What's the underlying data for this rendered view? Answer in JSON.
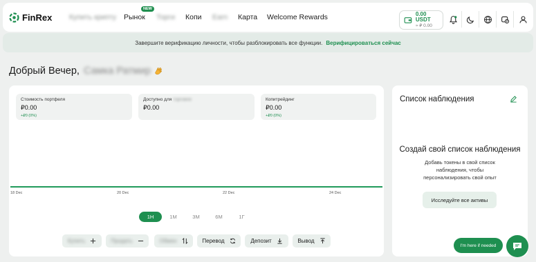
{
  "app": {
    "brand": "FinRex"
  },
  "nav": {
    "items": [
      {
        "label": "Купить криптy"
      },
      {
        "label": "Рынок",
        "badge": "NEW"
      },
      {
        "label": "Торги"
      },
      {
        "label": "Копи"
      },
      {
        "label": "Earn"
      },
      {
        "label": "Карта"
      },
      {
        "label": "Welcome Rewards"
      }
    ]
  },
  "header": {
    "balance_main": "0.00 USDT",
    "balance_sub": "≈ ₽ 0.00",
    "icons": [
      "bell-icon",
      "moon-icon",
      "globe-icon",
      "currency-icon",
      "user-icon"
    ]
  },
  "verify": {
    "text": "Завершите верификацию личности, чтобы разблокировать все функции.",
    "link": "Верифицироваться сейчас"
  },
  "greeting": {
    "text": "Добрый Вечер,",
    "name": "Самка Ратмир"
  },
  "stats": [
    {
      "label": "Стоимость портфеля",
      "value": "₽0.00",
      "change": "+₽0 (0%)"
    },
    {
      "label": "Доступно для",
      "label_suffix": "торговли",
      "value": "₽0.00"
    },
    {
      "label": "Копитрейдинг",
      "value": "₽0.00",
      "change": "+₽0 (0%)"
    }
  ],
  "chart_data": {
    "type": "line",
    "x": [
      "18 Dec",
      "20 Dec",
      "22 Dec",
      "24 Dec"
    ],
    "series": [
      {
        "values": [
          0,
          0,
          0,
          0
        ]
      }
    ],
    "title": "",
    "xlabel": "",
    "ylabel": ""
  },
  "ranges": {
    "items": [
      "1H",
      "1M",
      "3M",
      "6M",
      "1Г"
    ],
    "active": "1H"
  },
  "actions": [
    {
      "label": "Купить",
      "icon": "plus-icon",
      "blurred": true
    },
    {
      "label": "Продать",
      "icon": "minus-icon",
      "blurred": true
    },
    {
      "label": "Обмен",
      "icon": "swap-icon",
      "blurred": true
    },
    {
      "label": "Перевод",
      "icon": "refresh-icon"
    },
    {
      "label": "Депозит",
      "icon": "download-icon"
    },
    {
      "label": "Вывод",
      "icon": "upload-icon"
    }
  ],
  "watchlist": {
    "title": "Список наблюдения",
    "empty_title": "Создай свой список наблюдения",
    "empty_desc": "Добавь токены в свой список наблюдения, чтобы персонализировать свой опыт",
    "button": "Исследуйте все активы"
  },
  "help": {
    "label": "I'm here if needed"
  },
  "colors": {
    "accent": "#1e8f50",
    "background": "#eef0ef",
    "verify_bg": "#e3ebe7"
  }
}
